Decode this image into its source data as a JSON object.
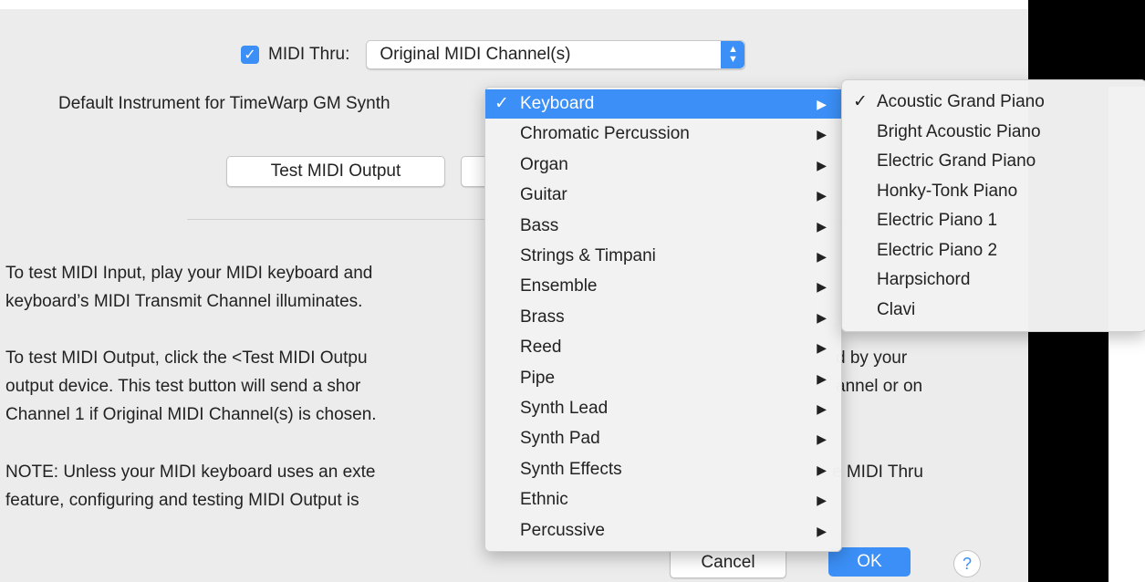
{
  "midi_thru": {
    "label": "MIDI Thru:",
    "checked": true,
    "value": "Original MIDI Channel(s)"
  },
  "default_instrument_label": "Default Instrument for TimeWarp GM Synth",
  "test_button": "Test MIDI Output",
  "paragraphs": [
    [
      "To test MIDI Input, play your MIDI keyboard and",
      "keyboard’s MIDI Transmit Channel illuminates."
    ],
    [
      "To test MIDI Output, click the <Test MIDI Outpu",
      "output device. This test button will send a shor",
      "Channel 1 if Original MIDI Channel(s) is chosen."
    ],
    [
      "NOTE: Unless your MIDI keyboard uses an exte",
      "feature, configuring and testing MIDI Output is"
    ]
  ],
  "right_fragments": [
    "d by your",
    "annel or on",
    "e MIDI Thru"
  ],
  "menu_categories": [
    "Keyboard",
    "Chromatic Percussion",
    "Organ",
    "Guitar",
    "Bass",
    "Strings & Timpani",
    "Ensemble",
    "Brass",
    "Reed",
    "Pipe",
    "Synth Lead",
    "Synth Pad",
    "Synth Effects",
    "Ethnic",
    "Percussive"
  ],
  "selected_category": "Keyboard",
  "submenu_items": [
    "Acoustic Grand Piano",
    "Bright Acoustic Piano",
    "Electric Grand Piano",
    "Honky-Tonk Piano",
    "Electric Piano 1",
    "Electric Piano 2",
    "Harpsichord",
    "Clavi"
  ],
  "selected_instrument": "Acoustic Grand Piano",
  "cancel_button": "Cancel",
  "ok_button": "OK",
  "help_glyph": "?",
  "checkmark_glyph": "✓",
  "submenu_arrow_glyph": "▶",
  "accent_color": "#3b8ff6"
}
